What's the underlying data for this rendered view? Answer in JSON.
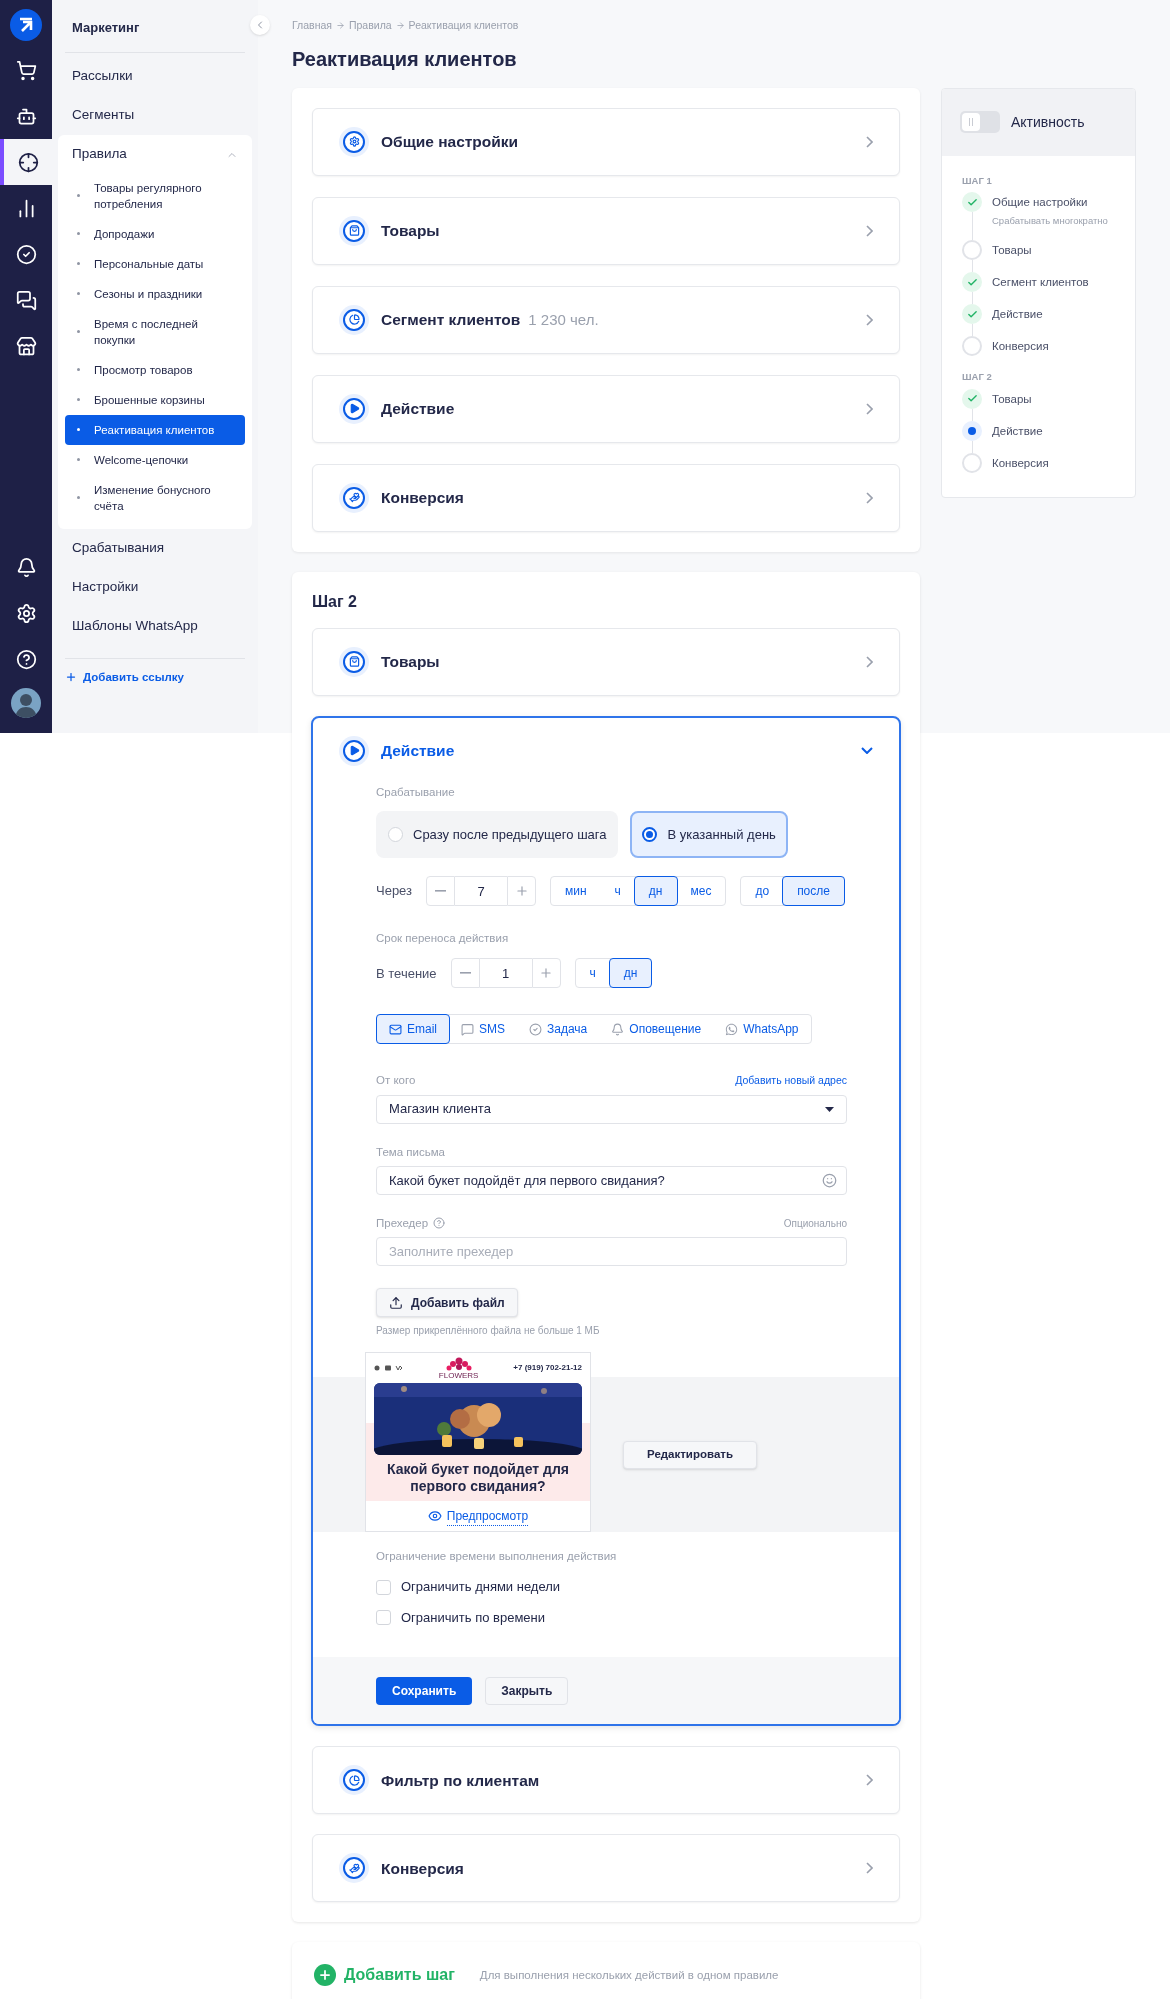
{
  "rail": {
    "items": [
      {
        "selected": false
      },
      {
        "selected": false
      },
      {
        "selected": true
      },
      {
        "selected": false
      },
      {
        "selected": false
      },
      {
        "selected": false
      },
      {
        "selected": false
      }
    ],
    "bottom_items": [
      {
        "selected": false
      },
      {
        "selected": false
      },
      {
        "selected": false
      }
    ]
  },
  "sidebar": {
    "title": "Маркетинг",
    "items": [
      {
        "kind": "link",
        "label": "Рассылки"
      },
      {
        "kind": "link",
        "label": "Сегменты"
      },
      {
        "kind": "group",
        "label": "Правила",
        "expanded": true,
        "children": [
          {
            "label": "Товары регулярного потребления",
            "selected": false
          },
          {
            "label": "Допродажи",
            "selected": false
          },
          {
            "label": "Персональные даты",
            "selected": false
          },
          {
            "label": "Сезоны и праздники",
            "selected": false
          },
          {
            "label": "Время с последней покупки",
            "selected": false
          },
          {
            "label": "Просмотр товаров",
            "selected": false
          },
          {
            "label": "Брошенные корзины",
            "selected": false
          },
          {
            "label": "Реактивация клиентов",
            "selected": true
          },
          {
            "label": "Welcome-цепочки",
            "selected": false
          },
          {
            "label": "Изменение бонусного счёта",
            "selected": false
          }
        ]
      },
      {
        "kind": "link",
        "label": "Срабатывания"
      },
      {
        "kind": "link",
        "label": "Настройки"
      },
      {
        "kind": "link",
        "label": "Шаблоны WhatsApp"
      }
    ],
    "add_link": "Добавить ссылку"
  },
  "breadcrumb": [
    "Главная",
    "Правила",
    "Реактивация клиентов"
  ],
  "title": "Реактивация клиентов",
  "step1": {
    "sections": [
      {
        "kind": "settings",
        "title": "Общие настройки",
        "expanded": false
      },
      {
        "kind": "products",
        "title": "Товары",
        "expanded": false
      },
      {
        "kind": "segment",
        "title": "Сегмент клиентов",
        "count": "1 230 чел.",
        "expanded": false
      },
      {
        "kind": "action",
        "title": "Действие",
        "expanded": false
      },
      {
        "kind": "conversion",
        "title": "Конверсия",
        "expanded": false
      }
    ]
  },
  "step2": {
    "title": "Шаг 2",
    "sections": [
      {
        "kind": "products",
        "title": "Товары",
        "expanded": false
      },
      {
        "kind": "action",
        "title": "Действие",
        "expanded": true,
        "form": {
          "trigger": {
            "label": "Срабатывание",
            "options": [
              {
                "label": "Сразу после предыдущего шага",
                "selected": false
              },
              {
                "label": "В указанный день",
                "selected": true
              }
            ]
          },
          "delay": {
            "label": "Через",
            "value": "7",
            "units": [
              {
                "label": "мин",
                "selected": false
              },
              {
                "label": "ч",
                "selected": false
              },
              {
                "label": "дн",
                "selected": true
              },
              {
                "label": "мес",
                "selected": false
              }
            ],
            "direction": [
              {
                "label": "до",
                "selected": false
              },
              {
                "label": "после",
                "selected": true
              }
            ]
          },
          "transfer": {
            "label": "Срок переноса действия",
            "field_label": "В течение",
            "value": "1",
            "units": [
              {
                "label": "ч",
                "selected": false
              },
              {
                "label": "дн",
                "selected": true
              }
            ]
          },
          "channels": [
            {
              "kind": "email",
              "label": "Email",
              "selected": true
            },
            {
              "kind": "sms",
              "label": "SMS",
              "selected": false
            },
            {
              "kind": "task",
              "label": "Задача",
              "selected": false
            },
            {
              "kind": "notification",
              "label": "Оповещение",
              "selected": false
            },
            {
              "kind": "whatsapp",
              "label": "WhatsApp",
              "selected": false
            }
          ],
          "sender": {
            "label": "От кого",
            "link": "Добавить новый адрес",
            "value": "Магазин клиента"
          },
          "subject": {
            "label": "Тема письма",
            "value": "Какой букет подойдёт для первого свидания?"
          },
          "preheader": {
            "label": "Прехедер",
            "hint": "Опционально",
            "placeholder": "Заполните прехедер"
          },
          "attach": {
            "button": "Добавить файл",
            "note": "Размер прикреплённого файла не больше 1 МБ"
          },
          "preview": {
            "logo": "FLOWERS",
            "phone": "+7 (919) 702-21-12",
            "headline": "Какой букет подойдет для первого свидания?",
            "link": "Предпросмотр",
            "edit_button": "Редактировать"
          },
          "limits": {
            "label": "Ограничение времени выполнения действия",
            "options": [
              {
                "label": "Ограничить днями недели",
                "checked": false
              },
              {
                "label": "Ограничить по времени",
                "checked": false
              }
            ]
          },
          "buttons": {
            "save": "Сохранить",
            "close": "Закрыть"
          }
        }
      },
      {
        "kind": "segment",
        "title": "Фильтр по клиентам",
        "expanded": false
      },
      {
        "kind": "conversion",
        "title": "Конверсия",
        "expanded": false
      }
    ]
  },
  "add_step": {
    "label": "Добавить шаг",
    "hint": "Для выполнения нескольких действий в одном правиле"
  },
  "activity": {
    "label": "Активность",
    "on": false,
    "steps": [
      {
        "title": "ШАГ 1",
        "items": [
          {
            "label": "Общие настройки",
            "kind": "done",
            "note": "Срабатывать многократно"
          },
          {
            "label": "Товары",
            "kind": "empty"
          },
          {
            "label": "Сегмент клиентов",
            "kind": "done"
          },
          {
            "label": "Действие",
            "kind": "done"
          },
          {
            "label": "Конверсия",
            "kind": "empty"
          }
        ]
      },
      {
        "title": "ШАГ 2",
        "items": [
          {
            "label": "Товары",
            "kind": "done"
          },
          {
            "label": "Действие",
            "kind": "current"
          },
          {
            "label": "Конверсия",
            "kind": "empty"
          }
        ]
      }
    ]
  }
}
